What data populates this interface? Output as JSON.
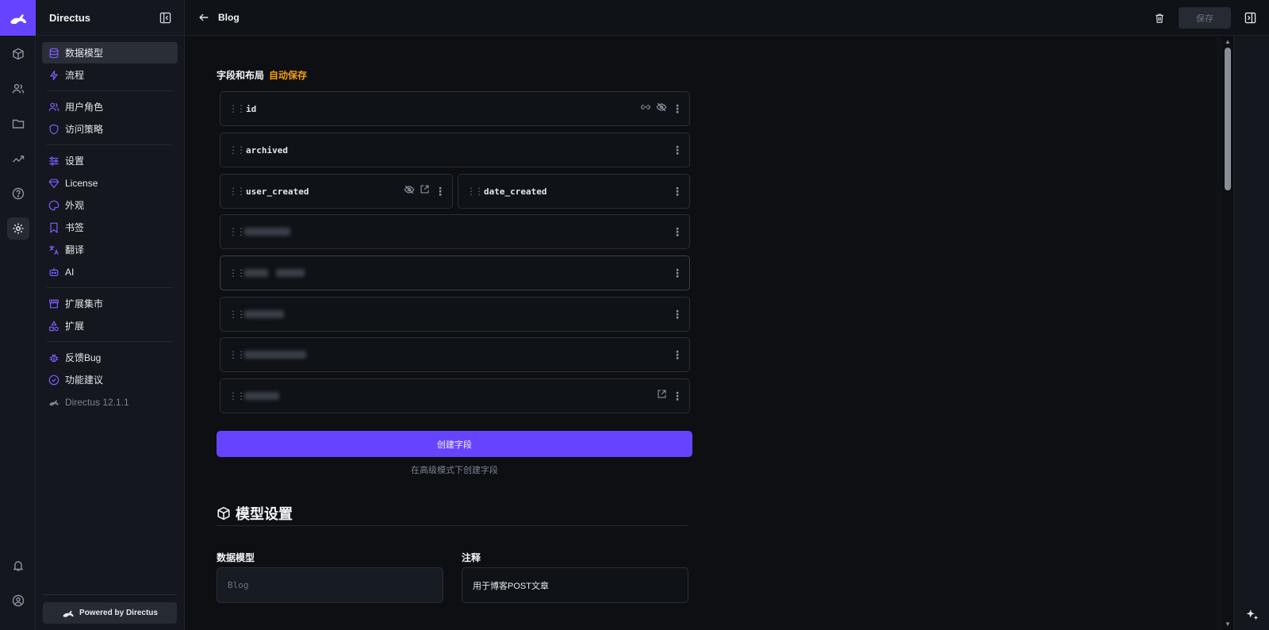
{
  "app": {
    "name": "Directus"
  },
  "breadcrumb": {
    "current": "Blog"
  },
  "toolbar": {
    "save_label": "保存"
  },
  "sidebar": {
    "groups": [
      [
        {
          "label": "数据模型",
          "icon": "database-icon",
          "active": true
        },
        {
          "label": "流程",
          "icon": "bolt-icon"
        }
      ],
      [
        {
          "label": "用户角色",
          "icon": "users-icon"
        },
        {
          "label": "访问策略",
          "icon": "shield-icon"
        }
      ],
      [
        {
          "label": "设置",
          "icon": "sliders-icon"
        },
        {
          "label": "License",
          "icon": "diamond-icon"
        },
        {
          "label": "外观",
          "icon": "palette-icon"
        },
        {
          "label": "书签",
          "icon": "bookmark-icon"
        },
        {
          "label": "翻译",
          "icon": "translate-icon"
        },
        {
          "label": "AI",
          "icon": "robot-icon"
        }
      ],
      [
        {
          "label": "扩展集市",
          "icon": "store-icon"
        },
        {
          "label": "扩展",
          "icon": "shapes-icon"
        }
      ],
      [
        {
          "label": "反馈Bug",
          "icon": "bug-icon"
        },
        {
          "label": "功能建议",
          "icon": "check-badge-icon"
        },
        {
          "label": "Directus 12.1.1",
          "icon": "directus-logo-icon",
          "muted": true
        }
      ]
    ],
    "powered_by": "Powered by Directus"
  },
  "fields_section": {
    "title": "字段和布局",
    "autosave": "自动保存"
  },
  "fields": {
    "id": "id",
    "archived": "archived",
    "user_created": "user_created",
    "date_created": "date_created"
  },
  "create_button": "创建字段",
  "advanced_link": "在高级模式下创建字段",
  "model_settings": {
    "title": "模型设置",
    "collection_label": "数据模型",
    "collection_value": "Blog",
    "note_label": "注释",
    "note_value": "用于博客POST文章"
  }
}
